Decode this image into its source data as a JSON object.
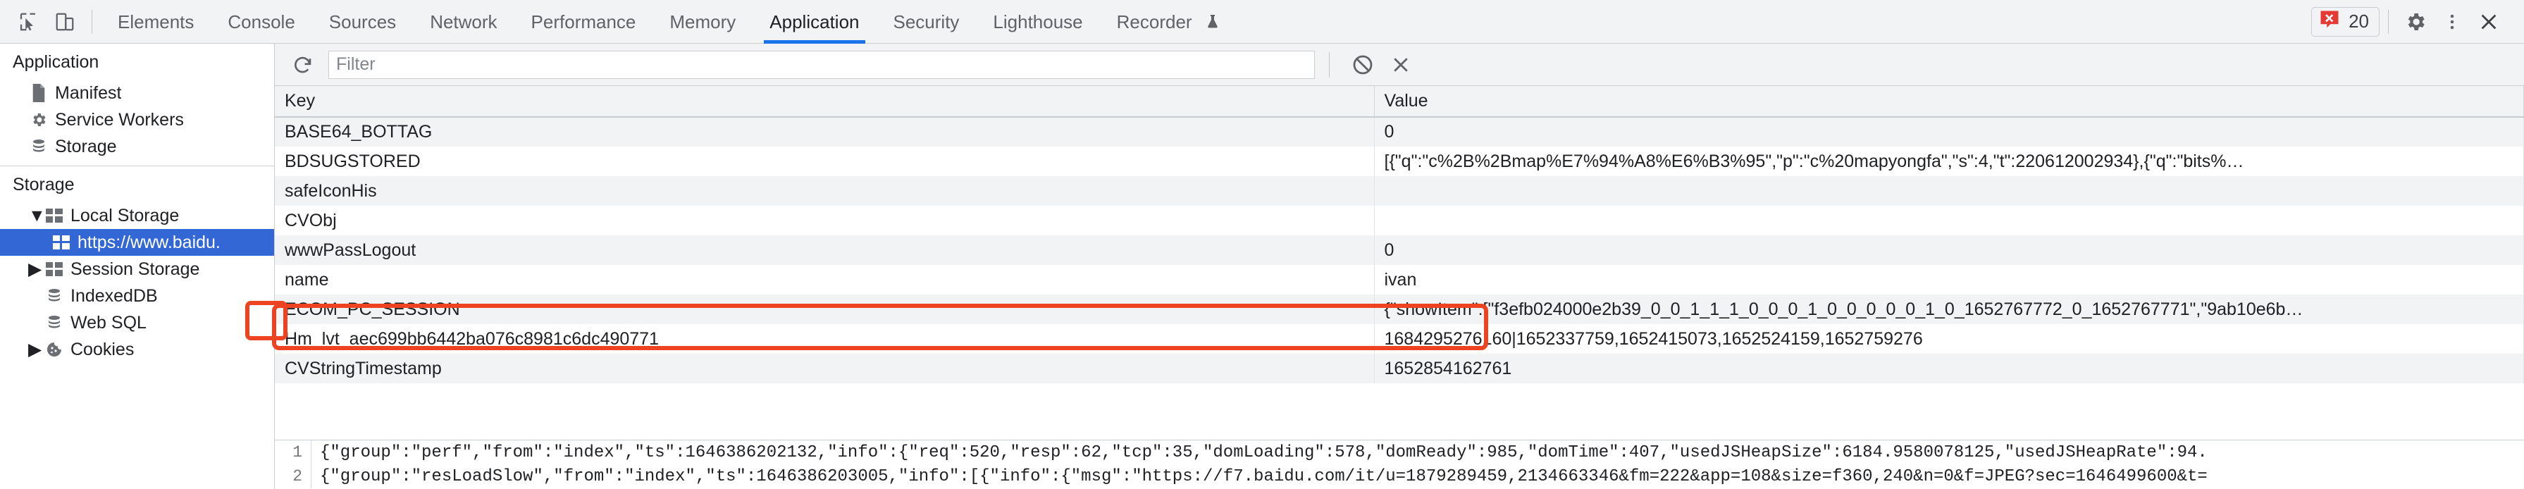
{
  "toolbar": {
    "inspect_icon": "inspect-cursor-icon",
    "device_toolbar_icon": "device-toolbar-icon",
    "tabs": [
      {
        "label": "Elements",
        "active": false
      },
      {
        "label": "Console",
        "active": false
      },
      {
        "label": "Sources",
        "active": false
      },
      {
        "label": "Network",
        "active": false
      },
      {
        "label": "Performance",
        "active": false
      },
      {
        "label": "Memory",
        "active": false
      },
      {
        "label": "Application",
        "active": true
      },
      {
        "label": "Security",
        "active": false
      },
      {
        "label": "Lighthouse",
        "active": false
      },
      {
        "label": "Recorder",
        "active": false,
        "icon": "flask-icon"
      }
    ],
    "error_count": "20",
    "error_icon": "error-x-icon",
    "settings_icon": "gear-icon",
    "more_icon": "kebab-menu-icon",
    "close_icon": "close-x-icon",
    "accent_color": "#1a73e8",
    "error_color": "#e53935"
  },
  "sidebar": {
    "application_title": "Application",
    "application_items": [
      {
        "label": "Manifest",
        "icon": "document-icon"
      },
      {
        "label": "Service Workers",
        "icon": "gear-icon"
      },
      {
        "label": "Storage",
        "icon": "database-icon"
      }
    ],
    "storage_title": "Storage",
    "storage_items": [
      {
        "label": "Local Storage",
        "icon": "table-grid-icon",
        "twisty": "▼",
        "indent": 1,
        "selected": false
      },
      {
        "label": "https://www.baidu.",
        "icon": "table-grid-icon",
        "twisty": "",
        "indent": 2,
        "selected": true
      },
      {
        "label": "Session Storage",
        "icon": "table-grid-icon",
        "twisty": "▶",
        "indent": 1,
        "selected": false
      },
      {
        "label": "IndexedDB",
        "icon": "database-icon",
        "twisty": "",
        "indent": 1,
        "selected": false
      },
      {
        "label": "Web SQL",
        "icon": "database-icon",
        "twisty": "",
        "indent": 1,
        "selected": false
      },
      {
        "label": "Cookies",
        "icon": "cookie-icon",
        "twisty": "▶",
        "indent": 1,
        "selected": false
      }
    ],
    "selected_color": "#3367d6"
  },
  "filter_bar": {
    "refresh_icon": "refresh-icon",
    "placeholder": "Filter",
    "value": "",
    "clear_all_icon": "clear-all-circle-slash-icon",
    "delete_selected_icon": "delete-x-icon"
  },
  "table": {
    "columns": [
      "Key",
      "Value"
    ],
    "rows": [
      {
        "key": "BASE64_BOTTAG",
        "value": "0"
      },
      {
        "key": "BDSUGSTORED",
        "value": "[{\"q\":\"c%2B%2Bmap%E7%94%A8%E6%B3%95\",\"p\":\"c%20mapyongfa\",\"s\":4,\"t\":220612002934},{\"q\":\"bits%…"
      },
      {
        "key": "safeIconHis",
        "value": ""
      },
      {
        "key": "CVObj",
        "value": ""
      },
      {
        "key": "wwwPassLogout",
        "value": "0"
      },
      {
        "key": "name",
        "value": "ivan"
      },
      {
        "key": "ECOM_PC_SESSION",
        "value": "{\"showItem\":[\"f3efb024000e2b39_0_0_1_1_1_0_0_0_1_0_0_0_0_0_1_0_1652767772_0_1652767771\",\"9ab10e6b…"
      },
      {
        "key": "Hm_lvt_aec699bb6442ba076c8981c6dc490771",
        "value": "1684295276160|1652337759,1652415073,1652524159,1652759276"
      },
      {
        "key": "CVStringTimestamp",
        "value": "1652854162761"
      }
    ],
    "highlighted_row_key": "name"
  },
  "preview": {
    "lines": [
      {
        "no": "1",
        "text": "{\"group\":\"perf\",\"from\":\"index\",\"ts\":1646386202132,\"info\":{\"req\":520,\"resp\":62,\"tcp\":35,\"domLoading\":578,\"domReady\":985,\"domTime\":407,\"usedJSHeapSize\":6184.9580078125,\"usedJSHeapRate\":94."
      },
      {
        "no": "2",
        "text": "{\"group\":\"resLoadSlow\",\"from\":\"index\",\"ts\":1646386203005,\"info\":[{\"info\":{\"msg\":\"https://f7.baidu.com/it/u=1879289459,2134663346&fm=222&app=108&size=f360,240&n=0&f=JPEG?sec=1646499600&t="
      }
    ]
  },
  "annotations": {
    "color": "#ec4323",
    "boxes": [
      "name-row-highlight",
      "sidebar-origin-highlight"
    ]
  }
}
